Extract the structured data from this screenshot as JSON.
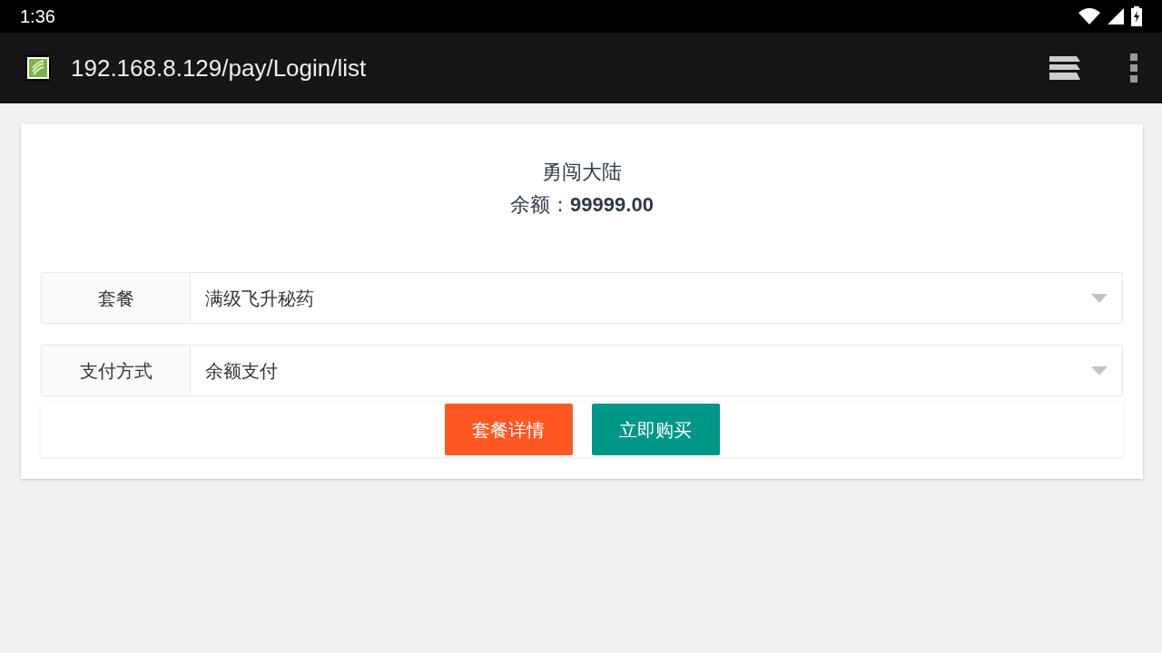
{
  "status_bar": {
    "time": "1:36"
  },
  "browser": {
    "url": "192.168.8.129/pay/Login/list"
  },
  "header": {
    "title": "勇闯大陆",
    "balance": "余额：**99999.00**"
  },
  "fields": [
    {
      "label": "套餐",
      "value": "满级飞升秘药"
    },
    {
      "label": "支付方式",
      "value": "余额支付"
    }
  ],
  "buttons": [
    {
      "label": "套餐详情",
      "color": "#ff5722"
    },
    {
      "label": "立即购买",
      "color": "#009688"
    }
  ]
}
